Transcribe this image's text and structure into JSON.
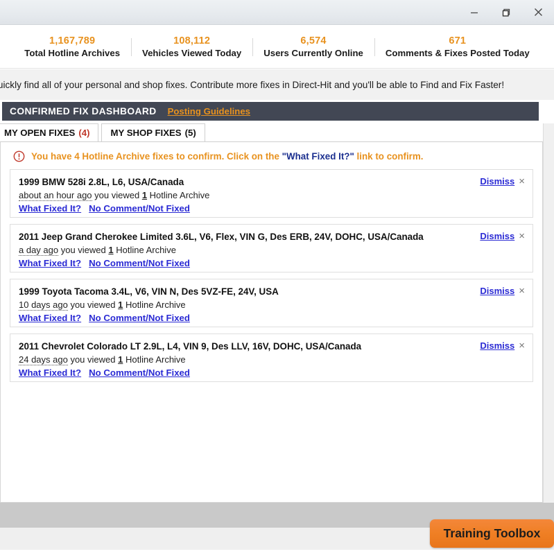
{
  "window": {
    "controls": [
      {
        "name": "minimize",
        "glyph": "minimize-icon"
      },
      {
        "name": "restore",
        "glyph": "restore-icon"
      },
      {
        "name": "close",
        "glyph": "close-icon"
      }
    ]
  },
  "stats": [
    {
      "value": "1,167,789",
      "label": "Total Hotline Archives"
    },
    {
      "value": "108,112",
      "label": "Vehicles Viewed Today"
    },
    {
      "value": "6,574",
      "label": "Users Currently Online"
    },
    {
      "value": "671",
      "label": "Comments & Fixes Posted Today"
    }
  ],
  "promo": {
    "text": "d quickly find all of your personal and shop fixes. Contribute more fixes in Direct-Hit and you'll be able to Find and Fix Faster!"
  },
  "dashboard": {
    "title": "CONFIRMED FIX DASHBOARD",
    "link": "Posting Guidelines"
  },
  "tabs": [
    {
      "label": "MY OPEN FIXES",
      "count": "(4)",
      "active": true
    },
    {
      "label": "MY SHOP FIXES",
      "count": "(5)",
      "active": false
    }
  ],
  "alert": {
    "icon": "exclamation-circle-icon",
    "prefix": "You have 4 Hotline Archive fixes to confirm. Click on the ",
    "quoted": "\"What Fixed It?\"",
    "suffix": " link to confirm."
  },
  "card_actions": {
    "what_fixed_it": "What Fixed It?",
    "no_comment": "No Comment/Not Fixed",
    "dismiss": "Dismiss",
    "close_glyph": "×"
  },
  "cards": [
    {
      "title": "1999 BMW 528i 2.8L, L6, USA/Canada",
      "ago": "about an hour ago",
      "meta_mid": " you viewed ",
      "count": "1",
      "meta_end": " Hotline Archive"
    },
    {
      "title": "2011 Jeep Grand Cherokee Limited 3.6L, V6, Flex, VIN G, Des ERB, 24V, DOHC, USA/Canada",
      "ago": "a day ago",
      "meta_mid": " you viewed ",
      "count": "1",
      "meta_end": " Hotline Archive"
    },
    {
      "title": "1999 Toyota Tacoma 3.4L, V6, VIN N, Des 5VZ-FE, 24V, USA",
      "ago": "10 days ago",
      "meta_mid": " you viewed ",
      "count": "1",
      "meta_end": " Hotline Archive"
    },
    {
      "title": "2011 Chevrolet Colorado LT 2.9L, L4, VIN 9, Des LLV, 16V, DOHC, USA/Canada",
      "ago": "24 days ago",
      "meta_mid": " you viewed ",
      "count": "1",
      "meta_end": " Hotline Archive"
    }
  ],
  "footer": {
    "toolbox_label": "Training Toolbox"
  },
  "colors": {
    "accent_orange": "#e8921f",
    "button_orange": "#ef7f24",
    "link_blue": "#2a2ad4",
    "alert_red": "#c0392b",
    "header_slate": "#424754"
  }
}
